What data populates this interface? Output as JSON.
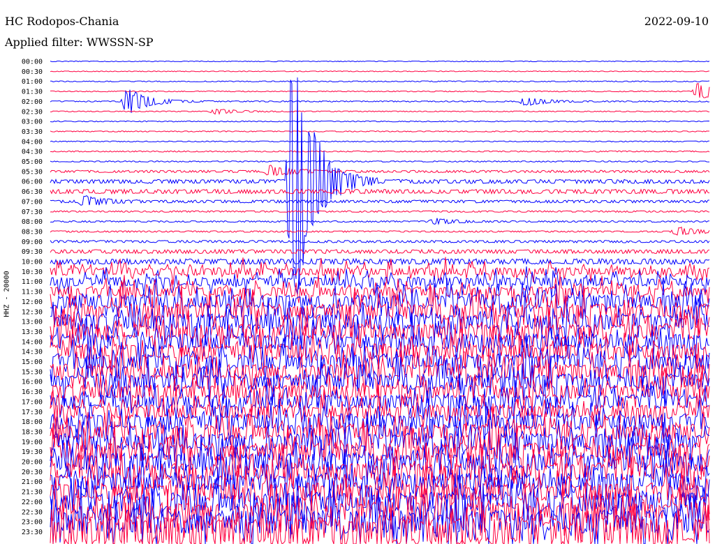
{
  "header": {
    "station": "HC Rodopos-Chania",
    "date": "2022-09-10",
    "filter_label": "Applied filter: WWSSN-SP"
  },
  "colors": {
    "blue": "#0000ff",
    "red": "#ff0040",
    "background": "#ffffff"
  },
  "chart_data": {
    "type": "line",
    "title": "HC Rodopos-Chania",
    "ylabel": "HHZ - 20000",
    "xlabel": "",
    "rows": [
      "00:00",
      "00:30",
      "01:00",
      "01:30",
      "02:00",
      "02:30",
      "03:00",
      "03:30",
      "04:00",
      "04:30",
      "05:00",
      "05:30",
      "06:00",
      "06:30",
      "07:00",
      "07:30",
      "08:00",
      "08:30",
      "09:00",
      "09:30",
      "10:00",
      "10:30",
      "11:00",
      "11:30",
      "12:00",
      "12:30",
      "13:00",
      "13:30",
      "14:00",
      "14:30",
      "15:00",
      "15:30",
      "16:00",
      "16:30",
      "17:00",
      "17:30",
      "18:00",
      "18:30",
      "19:00",
      "19:30",
      "20:00",
      "20:30",
      "21:00",
      "21:30",
      "22:00",
      "22:30",
      "23:00",
      "23:30"
    ],
    "row_colors": [
      "blue",
      "red"
    ],
    "row_minutes": 30,
    "noise_level": [
      0.4,
      0.4,
      0.5,
      0.5,
      0.6,
      0.5,
      0.5,
      0.5,
      0.5,
      0.6,
      0.6,
      1.2,
      2.0,
      2.2,
      1.4,
      0.8,
      0.8,
      0.8,
      1.2,
      2.0,
      2.8,
      4,
      4.5,
      5,
      7,
      8,
      8,
      8,
      8,
      8,
      8,
      8,
      8,
      7,
      7,
      7,
      8,
      8,
      9,
      9,
      9,
      9,
      9,
      9,
      10,
      10,
      12,
      14
    ],
    "events": [
      {
        "row": "02:00",
        "minute": 3.5,
        "amplitude": 20
      },
      {
        "row": "02:00",
        "minute": 21.6,
        "amplitude": 7
      },
      {
        "row": "01:30",
        "minute": 29.5,
        "amplitude": 14
      },
      {
        "row": "02:30",
        "minute": 7.5,
        "amplitude": 4
      },
      {
        "row": "05:30",
        "minute": 10,
        "amplitude": 8
      },
      {
        "row": "06:00",
        "minute": 11,
        "amplitude": 220
      },
      {
        "row": "07:00",
        "minute": 1.5,
        "amplitude": 8
      },
      {
        "row": "08:00",
        "minute": 17.5,
        "amplitude": 5
      },
      {
        "row": "08:30",
        "minute": 28.5,
        "amplitude": 7
      }
    ]
  }
}
